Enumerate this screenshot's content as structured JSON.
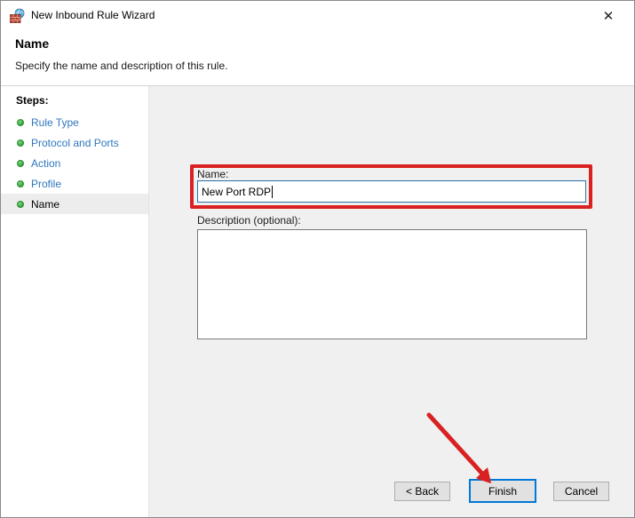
{
  "window": {
    "title": "New Inbound Rule Wizard",
    "close_glyph": "✕"
  },
  "header": {
    "title": "Name",
    "subtitle": "Specify the name and description of this rule."
  },
  "steps": {
    "label": "Steps:",
    "items": [
      {
        "label": "Rule Type",
        "current": false
      },
      {
        "label": "Protocol and Ports",
        "current": false
      },
      {
        "label": "Action",
        "current": false
      },
      {
        "label": "Profile",
        "current": false
      },
      {
        "label": "Name",
        "current": true
      }
    ]
  },
  "form": {
    "name_label": "Name:",
    "name_value": "New Port RDP",
    "description_label": "Description (optional):",
    "description_value": ""
  },
  "buttons": {
    "back": "< Back",
    "finish": "Finish",
    "cancel": "Cancel"
  },
  "colors": {
    "annotation_red": "#d92121",
    "focus_blue": "#0078d7",
    "step_link_blue": "#2e77be",
    "bullet_green": "#3fae49",
    "content_bg": "#f0f0f0"
  }
}
